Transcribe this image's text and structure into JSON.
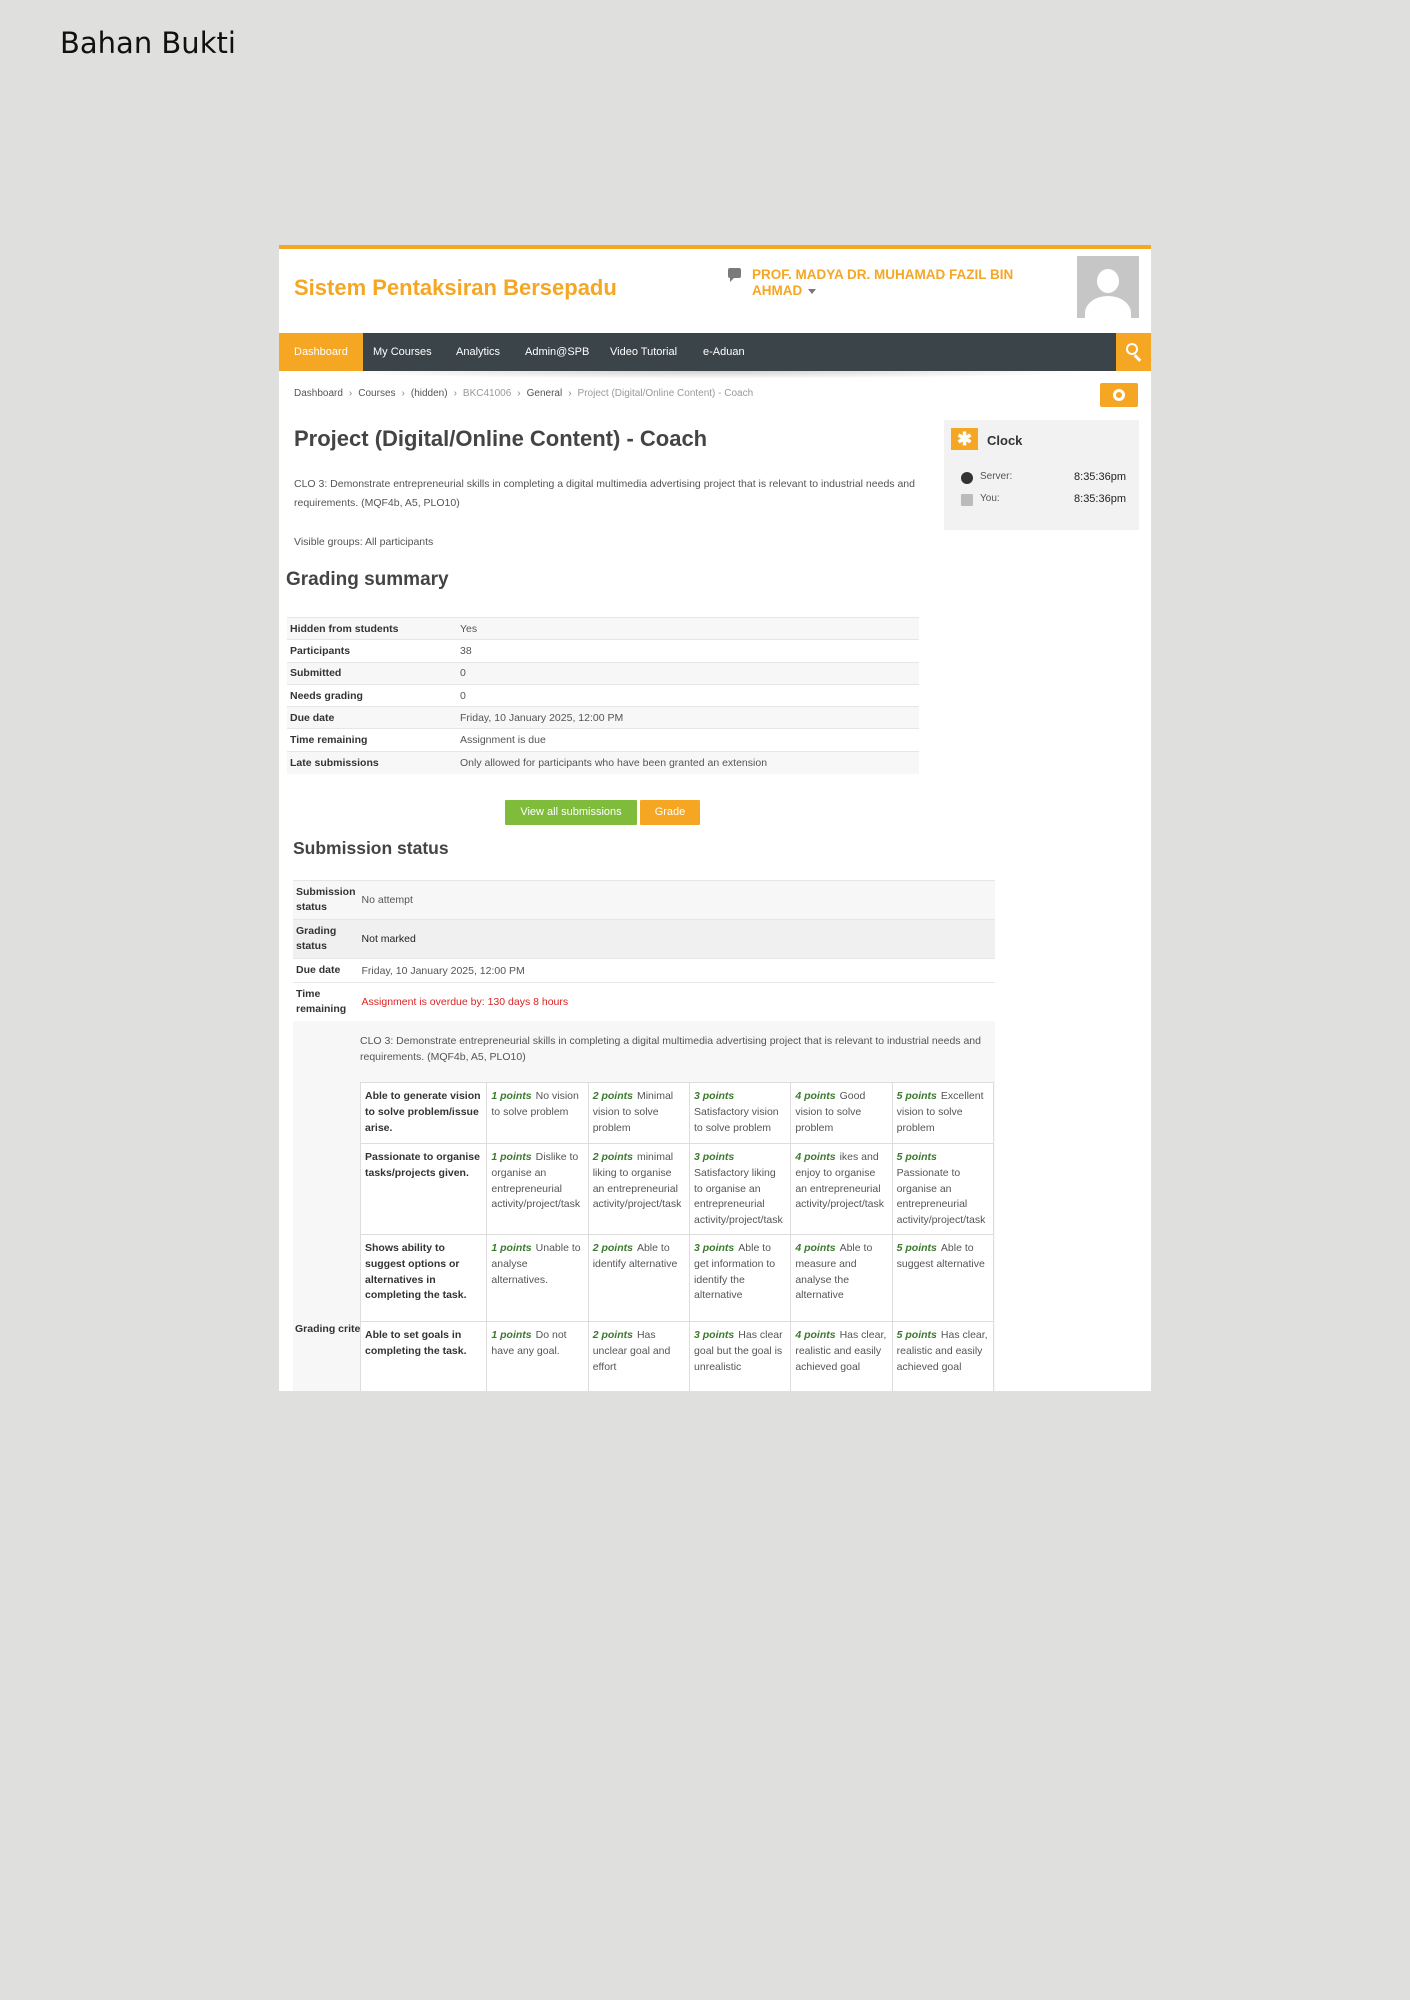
{
  "document": {
    "title": "Bahan Bukti"
  },
  "header": {
    "site_name": "Sistem Pentaksiran Bersepadu",
    "user_name": "PROF. MADYA DR. MUHAMAD FAZIL BIN AHMAD"
  },
  "nav": {
    "items": [
      "Dashboard",
      "My Courses",
      "Analytics",
      "Admin@SPB",
      "Video Tutorial",
      "e-Aduan"
    ],
    "active": "Dashboard"
  },
  "breadcrumb": [
    "Dashboard",
    "Courses",
    "(hidden)",
    "BKC41006",
    "General",
    "Project (Digital/Online Content) - Coach"
  ],
  "clock": {
    "title": "Clock",
    "server_label": "Server:",
    "server_time": "8:35:36pm",
    "you_label": "You:",
    "you_time": "8:35:36pm"
  },
  "page": {
    "title": "Project (Digital/Online Content) - Coach",
    "intro": "CLO 3: Demonstrate entrepreneurial skills in completing a digital multimedia advertising project that is relevant to industrial needs and requirements.  (MQF4b, A5, PLO10)",
    "visible_groups": "Visible groups: All participants"
  },
  "grading_summary": {
    "title": "Grading summary",
    "rows": [
      {
        "label": "Hidden from students",
        "value": "Yes"
      },
      {
        "label": "Participants",
        "value": "38"
      },
      {
        "label": "Submitted",
        "value": "0"
      },
      {
        "label": "Needs grading",
        "value": "0"
      },
      {
        "label": "Due date",
        "value": "Friday, 10 January 2025, 12:00 PM"
      },
      {
        "label": "Time remaining",
        "value": "Assignment is due"
      },
      {
        "label": "Late submissions",
        "value": "Only allowed for participants who have been granted an extension"
      }
    ]
  },
  "buttons": {
    "view_all": "View all submissions",
    "grade": "Grade"
  },
  "submission_status": {
    "title": "Submission status",
    "rows": [
      {
        "label": "Submission status",
        "value": "No attempt"
      },
      {
        "label": "Grading status",
        "value": "Not marked"
      },
      {
        "label": "Due date",
        "value": "Friday, 10 January 2025, 12:00 PM"
      },
      {
        "label": "Time remaining",
        "value": "Assignment is overdue by: 130 days 8 hours"
      }
    ],
    "grading_criteria_label": "Grading criteria",
    "clo": "CLO 3: Demonstrate entrepreneurial skills in completing a digital multimedia advertising project that is relevant to industrial needs and requirements.  (MQF4b, A5, PLO10)"
  },
  "rubric": [
    {
      "criterion": "Able to generate vision to solve problem/issue arise.",
      "levels": [
        {
          "points": "1 points",
          "desc": "No vision to solve problem"
        },
        {
          "points": "2 points",
          "desc": "Minimal vision to solve problem"
        },
        {
          "points": "3 points",
          "desc": "Satisfactory vision to solve problem"
        },
        {
          "points": "4 points",
          "desc": "Good vision to solve problem"
        },
        {
          "points": "5 points",
          "desc": "Excellent vision to solve problem"
        }
      ]
    },
    {
      "criterion": "Passionate to organise tasks/projects given.",
      "levels": [
        {
          "points": "1 points",
          "desc": "Dislike to organise an entrepreneurial activity/project/task"
        },
        {
          "points": "2 points",
          "desc": "minimal liking to organise an entrepreneurial activity/project/task"
        },
        {
          "points": "3 points",
          "desc": "Satisfactory liking to organise an entrepreneurial activity/project/task"
        },
        {
          "points": "4 points",
          "desc": "ikes and enjoy to organise an entrepreneurial activity/project/task"
        },
        {
          "points": "5 points",
          "desc": "Passionate to organise an entrepreneurial activity/project/task"
        }
      ]
    },
    {
      "criterion": "Shows ability to suggest options or alternatives in completing the task.",
      "levels": [
        {
          "points": "1 points",
          "desc": "Unable to analyse alternatives."
        },
        {
          "points": "2 points",
          "desc": "Able to identify alternative"
        },
        {
          "points": "3 points",
          "desc": "Able to get information to identify the alternative"
        },
        {
          "points": "4 points",
          "desc": "Able to measure and analyse the alternative"
        },
        {
          "points": "5 points",
          "desc": "Able to suggest alternative"
        }
      ]
    },
    {
      "criterion": "Able to set goals in completing the task.",
      "levels": [
        {
          "points": "1 points",
          "desc": "Do not have any goal."
        },
        {
          "points": "2 points",
          "desc": "Has unclear goal and effort"
        },
        {
          "points": "3 points",
          "desc": "Has clear goal but the goal is unrealistic"
        },
        {
          "points": "4 points",
          "desc": "Has clear, realistic and easily achieved goal"
        },
        {
          "points": "5 points",
          "desc": "Has clear, realistic and easily achieved goal"
        }
      ]
    }
  ],
  "colors": {
    "accent": "#f5a623",
    "navbar": "#3a4449",
    "button_green": "#7fbc3c",
    "points_green": "#3c7a2e",
    "overdue_red": "#dd2222"
  }
}
